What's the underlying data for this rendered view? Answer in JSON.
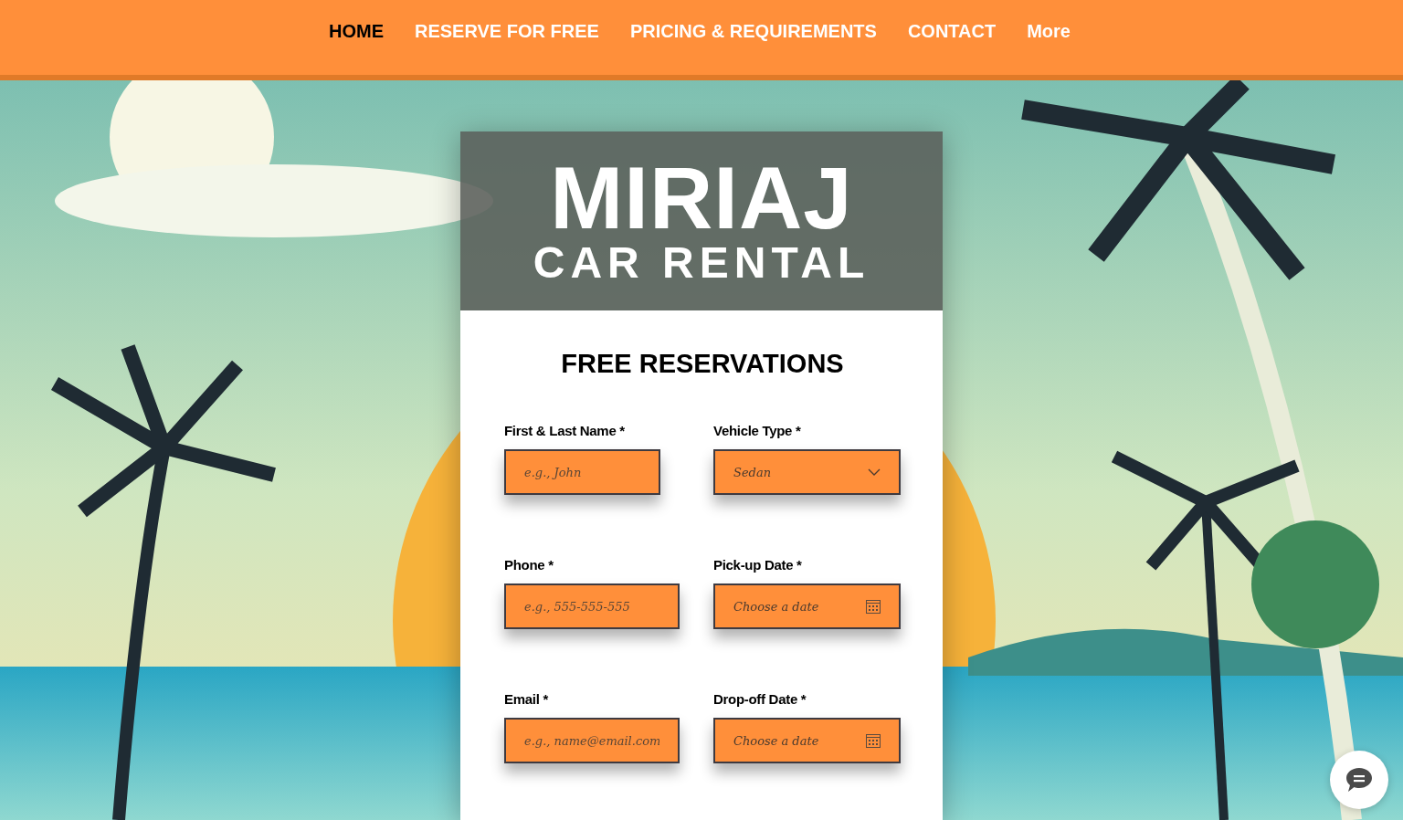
{
  "nav": [
    {
      "label": "HOME",
      "selected": true
    },
    {
      "label": "RESERVE FOR FREE",
      "selected": false
    },
    {
      "label": "PRICING & REQUIREMENTS",
      "selected": false
    },
    {
      "label": "CONTACT",
      "selected": false
    },
    {
      "label": "More",
      "selected": false
    }
  ],
  "brand": {
    "title": "MIRIAJ",
    "subtitle": "CAR RENTAL"
  },
  "form": {
    "heading": "FREE RESERVATIONS",
    "fields": [
      {
        "kind": "text",
        "label": "First & Last Name *",
        "placeholder": "e.g., John"
      },
      {
        "kind": "select",
        "label": "Vehicle Type *",
        "value": "Sedan"
      },
      {
        "kind": "text",
        "label": "Phone *",
        "placeholder": "e.g., 555-555-555"
      },
      {
        "kind": "date",
        "label": "Pick-up Date *",
        "placeholder": "Choose a date"
      },
      {
        "kind": "text",
        "label": "Email *",
        "placeholder": "e.g., name@email.com"
      },
      {
        "kind": "date",
        "label": "Drop-off Date *",
        "placeholder": "Choose a date"
      }
    ]
  }
}
